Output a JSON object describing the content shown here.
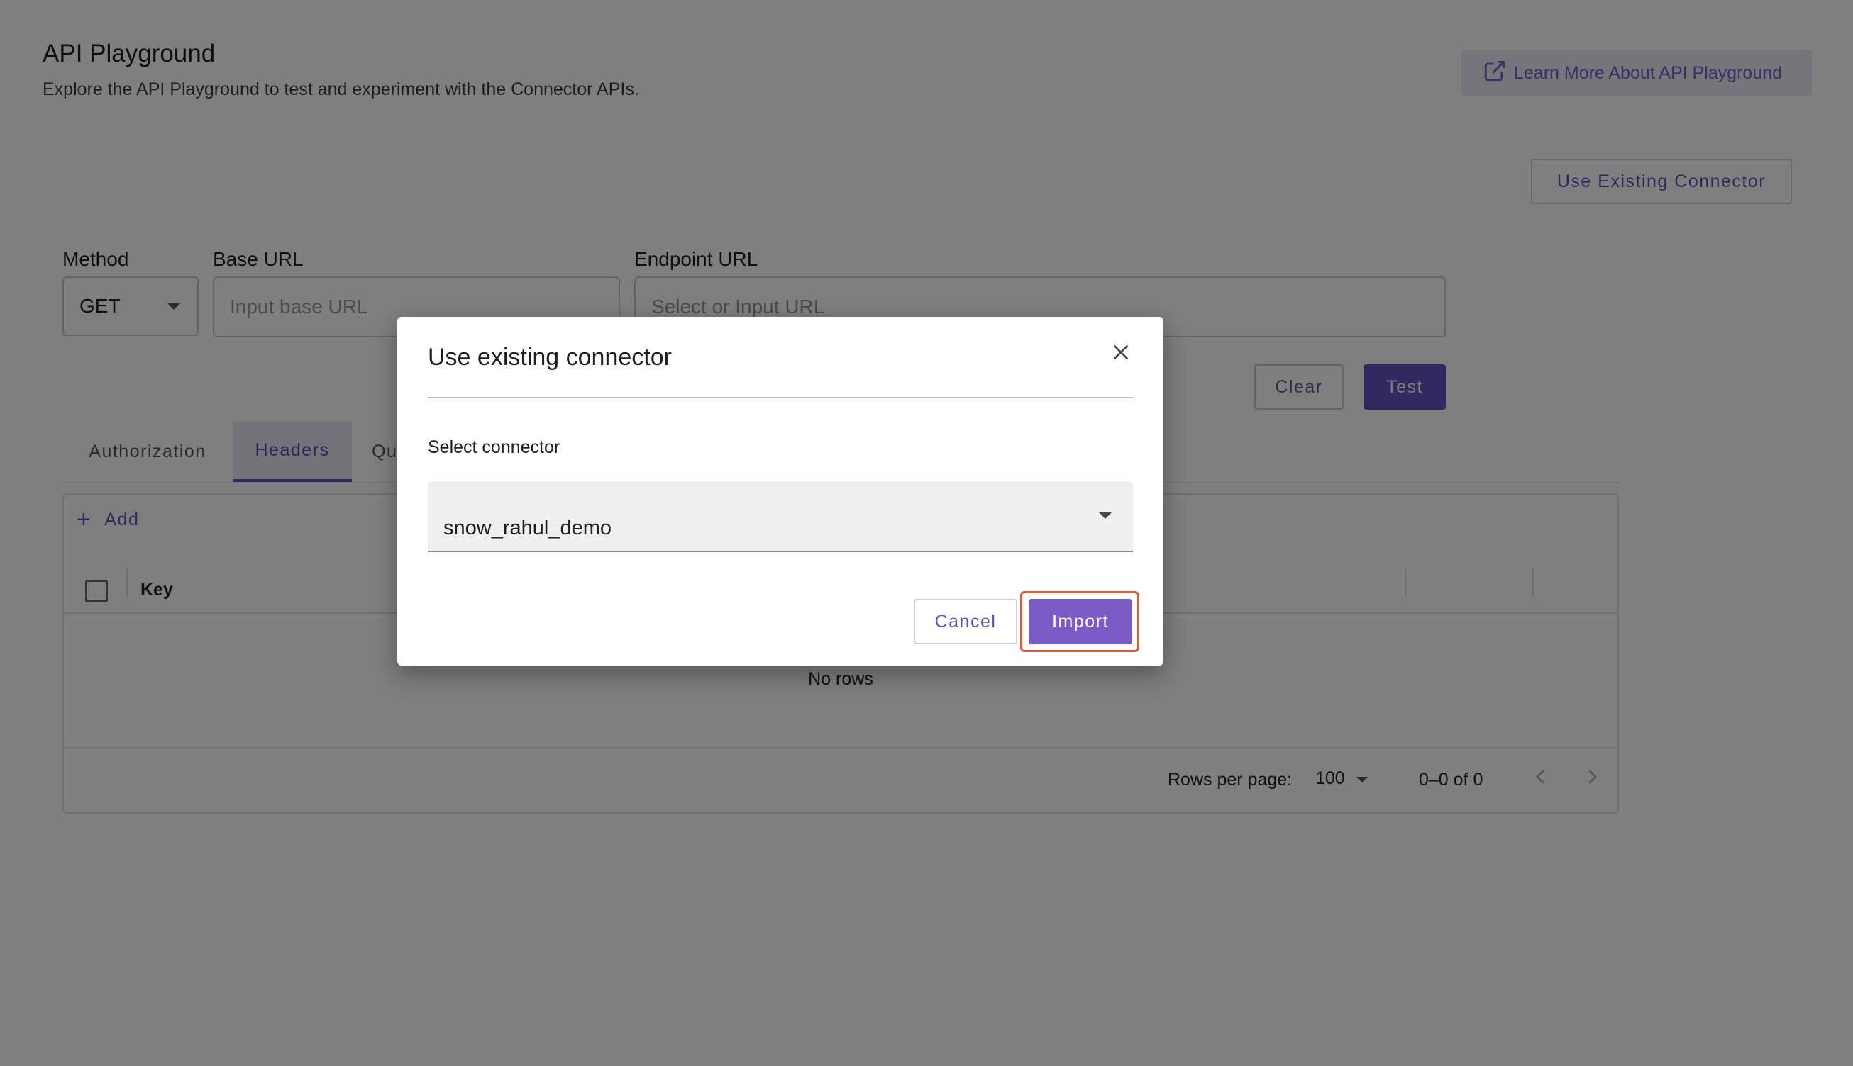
{
  "header": {
    "title": "API Playground",
    "subtitle": "Explore the API Playground to test and experiment with the Connector APIs.",
    "learn_more_label": "Learn More About API Playground",
    "learn_more_icon": "external-link-icon"
  },
  "toolbar": {
    "use_existing_label": "Use Existing Connector"
  },
  "request": {
    "method_label": "Method",
    "method_value": "GET",
    "base_url_label": "Base URL",
    "base_url_placeholder": "Input base URL",
    "endpoint_label": "Endpoint URL",
    "endpoint_placeholder": "Select or Input URL",
    "clear_label": "Clear",
    "test_label": "Test"
  },
  "tabs": [
    {
      "label": "Authorization",
      "active": false
    },
    {
      "label": "Headers",
      "active": true
    },
    {
      "label": "Qu",
      "active": false
    }
  ],
  "grid": {
    "add_label": "Add",
    "columns": [
      "Key"
    ],
    "empty_text": "No rows",
    "rows_per_page_label": "Rows per page:",
    "rows_per_page_value": "100",
    "page_info": "0–0 of 0"
  },
  "dialog": {
    "title": "Use existing connector",
    "select_label": "Select connector",
    "selected_connector": "snow_rahul_demo",
    "cancel_label": "Cancel",
    "import_label": "Import"
  },
  "colors": {
    "accent": "#7b5cc7",
    "accent_dark": "#6b4fbf",
    "highlight": "#e05a3a",
    "overlay": "rgba(0,0,0,0.5)"
  }
}
